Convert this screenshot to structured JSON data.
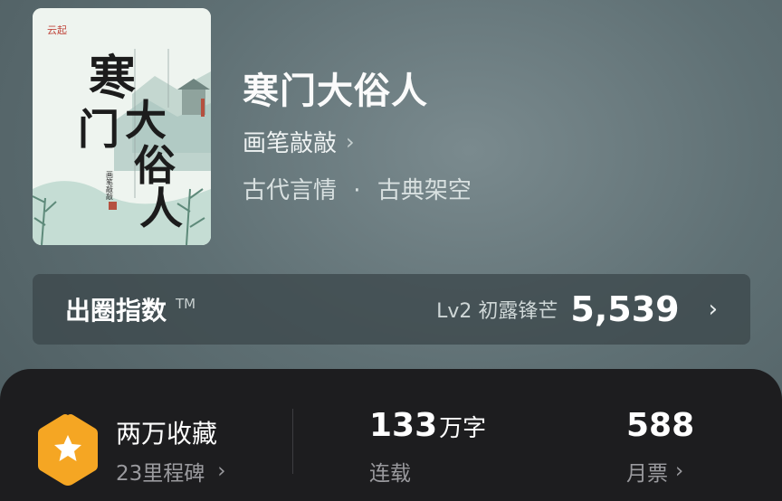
{
  "book": {
    "title": "寒门大俗人",
    "author": "画笔敲敲",
    "genre_primary": "古代言情",
    "genre_separator": "·",
    "genre_secondary": "古典架空",
    "cover": {
      "title_art": "寒门大俗人",
      "author_art": "画笔敲敲",
      "logo_text": "云起"
    }
  },
  "influence_index": {
    "label": "出圈指数",
    "trademark": "TM",
    "level": "Lv2 初露锋芒",
    "score": "5,539"
  },
  "stats": {
    "favorites_title": "两万收藏",
    "milestones": "23里程碑",
    "word_count_number": "133",
    "word_count_unit": "万字",
    "status": "连载",
    "monthly_tickets_count": "588",
    "monthly_tickets_label": "月票"
  },
  "colors": {
    "badge_orange": "#f5a623",
    "panel_dark": "#1d1d1f"
  },
  "icons": {
    "author_chevron": "chevron-right-icon",
    "index_chevron": "chevron-right-icon",
    "badge": "star-hexagon-icon"
  }
}
